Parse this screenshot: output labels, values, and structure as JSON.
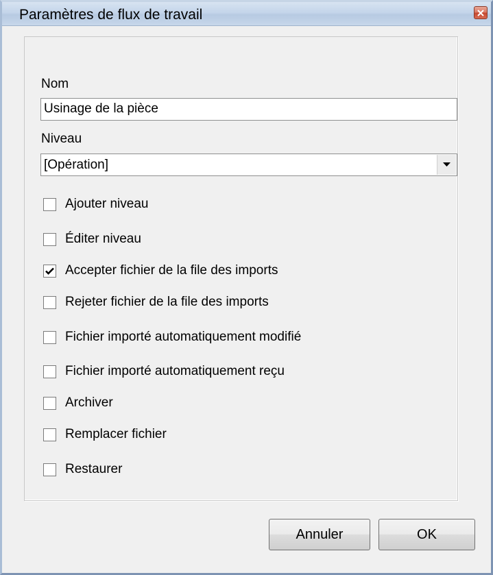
{
  "window": {
    "title": "Paramètres de flux de travail"
  },
  "form": {
    "name_label": "Nom",
    "name_value": "Usinage de la pièce",
    "level_label": "Niveau",
    "level_value": "[Opération]"
  },
  "options": [
    {
      "label": "Ajouter niveau",
      "checked": false
    },
    {
      "label": "Éditer niveau",
      "checked": false
    },
    {
      "label": "Accepter fichier de la file des imports",
      "checked": true
    },
    {
      "label": "Rejeter fichier de la file des imports",
      "checked": false
    },
    {
      "label": "Fichier importé automatiquement modifié",
      "checked": false
    },
    {
      "label": "Fichier importé automatiquement reçu",
      "checked": false
    },
    {
      "label": "Archiver",
      "checked": false
    },
    {
      "label": "Remplacer fichier",
      "checked": false
    },
    {
      "label": "Restaurer",
      "checked": false
    }
  ],
  "buttons": {
    "cancel_label": "Annuler",
    "ok_label": "OK"
  },
  "icons": {
    "close": "close-icon",
    "dropdown": "chevron-down-icon",
    "check": "checkmark-icon"
  }
}
